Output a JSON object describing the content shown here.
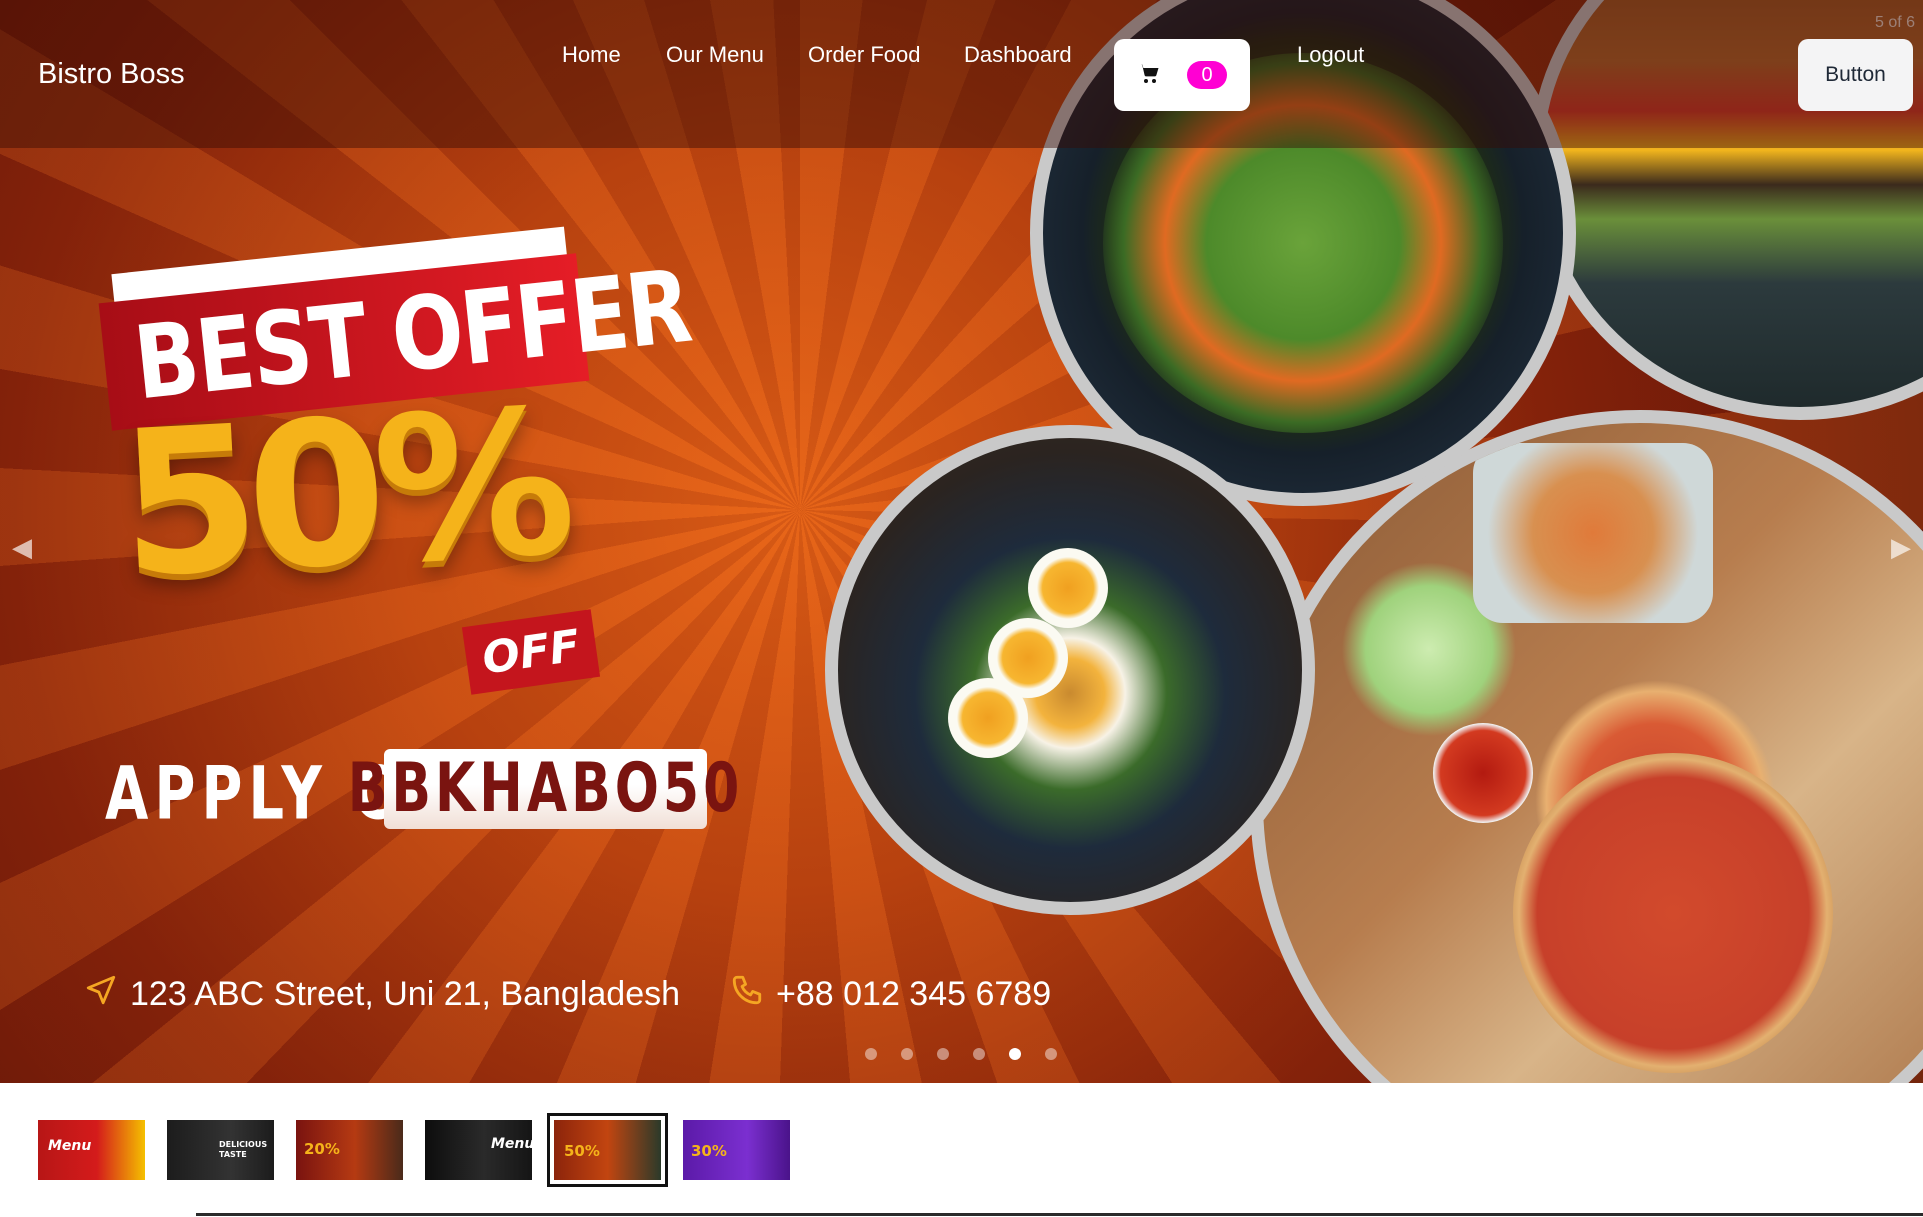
{
  "navbar": {
    "brand": "Bistro Boss",
    "links": [
      "Home",
      "Our Menu",
      "Order Food",
      "Dashboard",
      "Logout"
    ],
    "cart_count": "0",
    "button_label": "Button"
  },
  "slider": {
    "counter": "5 of 6",
    "active_index": 5,
    "total": 6
  },
  "offer": {
    "headline": "BEST OFFER",
    "percent": "50%",
    "off": "OFF",
    "apply_label": "APPLY CODE",
    "code": "BBKHABO50"
  },
  "contact": {
    "address": "123 ABC Street, Uni 21, Bangladesh",
    "phone": "+88 012 345 6789"
  },
  "thumbnails": [
    {
      "text": "Menu"
    },
    {
      "text": "DELICIOUS TASTE"
    },
    {
      "text": "20%"
    },
    {
      "text": "Menu"
    },
    {
      "text": "50%"
    },
    {
      "text": "30%"
    }
  ],
  "colors": {
    "accent_badge": "#ff00d3",
    "hero_dark": "#5a1207",
    "hero_light": "#e45f16",
    "offer_red": "#c4151d",
    "offer_gold": "#f5b31a"
  },
  "icons": [
    "cart-icon",
    "location-arrow-icon",
    "phone-icon",
    "chevron-left-icon",
    "chevron-right-icon"
  ]
}
